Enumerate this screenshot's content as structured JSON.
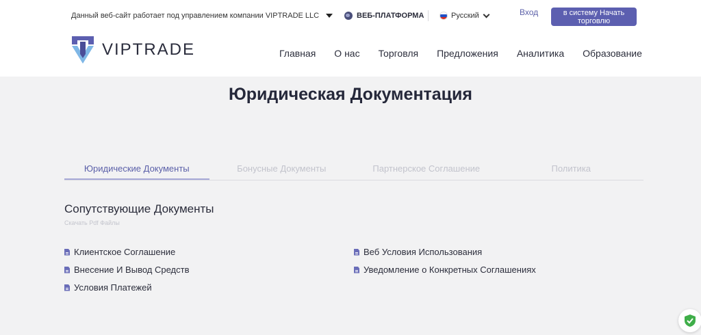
{
  "topbar": {
    "company_note": "Данный веб-сайт работает под управлением компании VIPTRADE LLC",
    "platform_label": "ВЕБ-ПЛАТФОРМА",
    "language": "Русский",
    "login_label": "Вход",
    "cta_label": "в систему Начать торговлю"
  },
  "brand": {
    "name": "VIPTRADE",
    "accent": "#5c5fb0"
  },
  "nav": {
    "items": [
      {
        "label": "Главная"
      },
      {
        "label": "О нас"
      },
      {
        "label": "Торговля"
      },
      {
        "label": "Предложения"
      },
      {
        "label": "Аналитика"
      },
      {
        "label": "Образование"
      }
    ]
  },
  "page": {
    "title": "Юридическая Документация"
  },
  "tabs": [
    {
      "label": "Юридические Документы",
      "active": true
    },
    {
      "label": "Бонусные Документы",
      "active": false
    },
    {
      "label": "Партнерское Соглашение",
      "active": false
    },
    {
      "label": "Политика",
      "active": false
    }
  ],
  "section": {
    "title": "Сопутствующие Документы",
    "subtitle": "Скачать Pdf Файлы",
    "documents_left": [
      {
        "label": "Клиентское Соглашение"
      },
      {
        "label": "Внесение И Вывод Средств"
      },
      {
        "label": "Условия Платежей"
      }
    ],
    "documents_right": [
      {
        "label": "Веб Условия Использования"
      },
      {
        "label": "Уведомление о Конкретных Соглашениях"
      }
    ]
  },
  "icons": {
    "dropdown": "caret-down-icon",
    "platform": "globe-icon",
    "flag": "russian-flag-icon",
    "document": "file-icon",
    "badge": "shield-check-icon"
  }
}
